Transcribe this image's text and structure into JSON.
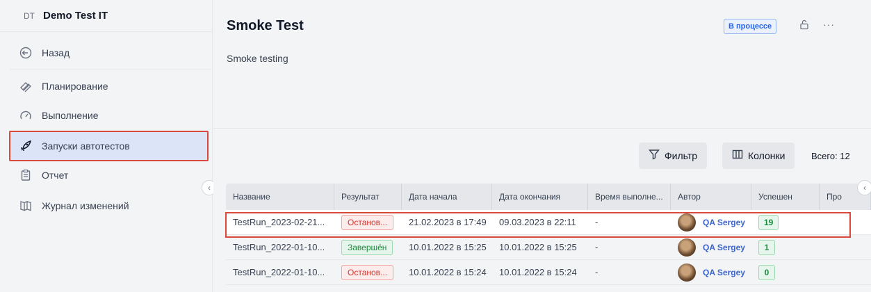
{
  "workspace": {
    "abbr": "DT",
    "name": "Demo Test IT"
  },
  "sidebar": {
    "items": [
      {
        "label": "Назад",
        "icon": "back-arrow-icon"
      },
      {
        "label": "Планирование",
        "icon": "planning-icon"
      },
      {
        "label": "Выполнение",
        "icon": "speedometer-icon"
      },
      {
        "label": "Запуски автотестов",
        "icon": "rocket-icon",
        "active": true
      },
      {
        "label": "Отчет",
        "icon": "clipboard-icon"
      },
      {
        "label": "Журнал изменений",
        "icon": "book-icon"
      }
    ]
  },
  "header": {
    "title": "Smoke Test",
    "description": "Smoke testing",
    "status": "В процессе",
    "status_color": "#2563eb"
  },
  "toolbar": {
    "filter_label": "Фильтр",
    "columns_label": "Колонки",
    "total_label": "Всего: 12"
  },
  "table": {
    "columns": [
      "Название",
      "Результат",
      "Дата начала",
      "Дата окончания",
      "Время выполне...",
      "Автор",
      "Успешен",
      "Про"
    ],
    "rows": [
      {
        "name": "TestRun_2023-02-21...",
        "result": "Останов...",
        "result_type": "stopped",
        "start": "21.02.2023 в 17:49",
        "end": "09.03.2023 в 22:11",
        "duration": "-",
        "author": "QA Sergey",
        "success": "19"
      },
      {
        "name": "TestRun_2022-01-10...",
        "result": "Завершён",
        "result_type": "done",
        "start": "10.01.2022 в 15:25",
        "end": "10.01.2022 в 15:25",
        "duration": "-",
        "author": "QA Sergey",
        "success": "1"
      },
      {
        "name": "TestRun_2022-01-10...",
        "result": "Останов...",
        "result_type": "stopped",
        "start": "10.01.2022 в 15:24",
        "end": "10.01.2022 в 15:24",
        "duration": "-",
        "author": "QA Sergey",
        "success": "0"
      }
    ]
  },
  "colors": {
    "accent_highlight": "#d94a3d",
    "author_link": "#3b63c9"
  }
}
